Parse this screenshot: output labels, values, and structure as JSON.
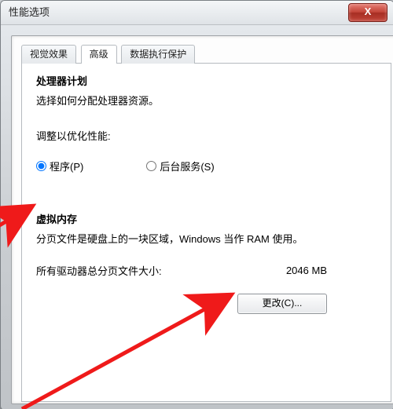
{
  "window": {
    "title": "性能选项",
    "close": "X"
  },
  "tabs": {
    "visual": "视觉效果",
    "advanced": "高级",
    "dep": "数据执行保护"
  },
  "proc": {
    "title": "处理器计划",
    "desc": "选择如何分配处理器资源。",
    "optimize_label": "调整以优化性能:",
    "radio_programs": "程序(P)",
    "radio_services": "后台服务(S)"
  },
  "vm": {
    "title": "虚拟内存",
    "desc": "分页文件是硬盘上的一块区域，Windows 当作 RAM 使用。",
    "total_label": "所有驱动器总分页文件大小:",
    "total_value": "2046 MB",
    "change_btn": "更改(C)..."
  }
}
